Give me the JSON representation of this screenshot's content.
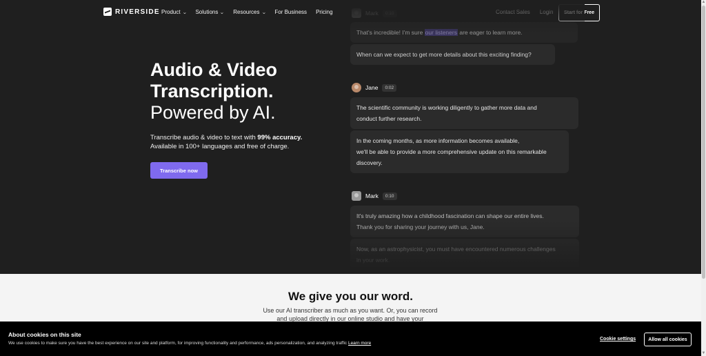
{
  "nav": {
    "logo": "RIVERSIDE",
    "links": [
      {
        "label": "Product",
        "dropdown": true
      },
      {
        "label": "Solutions",
        "dropdown": true
      },
      {
        "label": "Resources",
        "dropdown": true
      },
      {
        "label": "For Business",
        "dropdown": false
      },
      {
        "label": "Pricing",
        "dropdown": false
      }
    ],
    "contact": "Contact Sales",
    "login": "Login",
    "start": "Start for Free"
  },
  "hero": {
    "title_line1": "Audio & Video",
    "title_line2": "Transcription.",
    "title_line3": "Powered by AI.",
    "sub_pre": "Transcribe audio & video to text with ",
    "sub_bold": "99% accuracy.",
    "sub_line2": "Available in 100+ languages and free of charge.",
    "cta": "Transcribe now"
  },
  "chat": {
    "top_speaker": {
      "name": "Mark",
      "time": "0:10"
    },
    "top_msg1_pre": "That's incredible! I'm sure ",
    "top_msg1_hl": "our listeners",
    "top_msg1_post": " are eager to learn more.",
    "top_msg2": "When can we expect to get more details about this exciting finding?",
    "jane": {
      "name": "Jane",
      "time": "0:02"
    },
    "jane_msg1_l1": "The scientific community is working diligently to gather more data and",
    "jane_msg1_l2": "conduct further research.",
    "jane_msg2_l1": " In the coming months, as more information becomes available,",
    "jane_msg2_l2": "we'll be able to provide a more comprehensive update on this remarkable",
    "jane_msg2_l3": "discovery.",
    "mark": {
      "name": "Mark",
      "time": "0:10"
    },
    "mark_msg1_l1": "It's truly amazing how a childhood fascination can shape our entire lives.",
    "mark_msg1_l2": "Thank you for sharing your journey with us, Jane.",
    "mark_msg2_l1": "Now, as an astrophysicist, you must have encountered numerous challenges",
    "mark_msg2_l2": "in your work."
  },
  "section": {
    "title": "We give you our word.",
    "text_l1": "Use our AI transcriber as much as you want. Or, you can record",
    "text_l2": "and upload directly in our online studio and have your"
  },
  "cookie": {
    "title": "About cookies on this site",
    "text": "We use cookies to make sure you have the best experience on our site and platform, for improving functionality and performance, ads personalization, and analyzing traffic ",
    "learn_more": "Learn more",
    "settings": "Cookie settings",
    "allow": "Allow all cookies"
  }
}
